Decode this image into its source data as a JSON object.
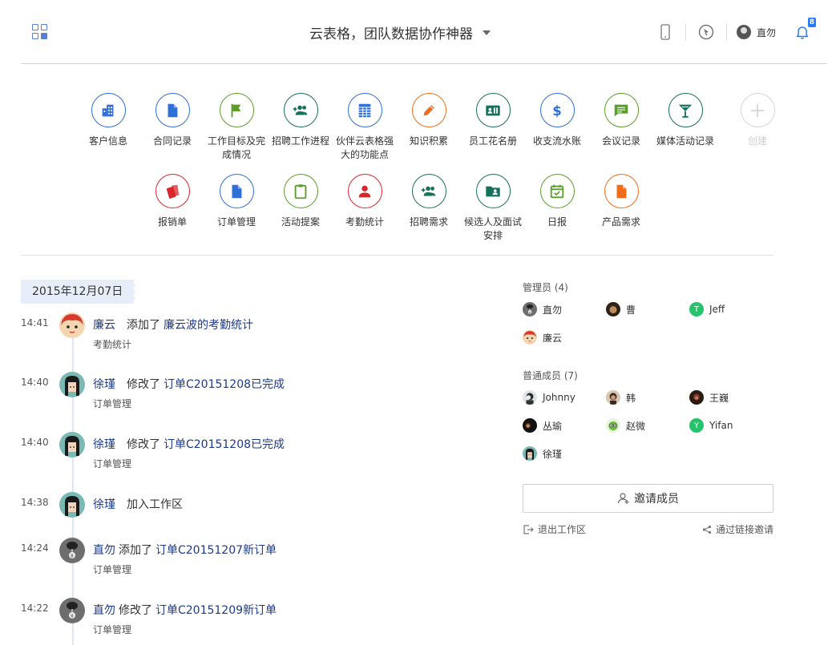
{
  "header": {
    "title": "云表格，团队数据协作神器",
    "user_name": "直勿",
    "notification_count": "8"
  },
  "apps": [
    {
      "label": "客户信息",
      "color": "#2f6fd6",
      "icon": "building-icon"
    },
    {
      "label": "合同记录",
      "color": "#2f6fd6",
      "icon": "document-icon"
    },
    {
      "label": "工作目标及完成情况",
      "color": "#5a9e2a",
      "icon": "flag-icon"
    },
    {
      "label": "招聘工作进程",
      "color": "#17705c",
      "icon": "group-add-icon"
    },
    {
      "label": "伙伴云表格强大的功能点",
      "color": "#2f6fd6",
      "icon": "table-icon"
    },
    {
      "label": "知识积累",
      "color": "#ef6c1a",
      "icon": "pencil-icon"
    },
    {
      "label": "员工花名册",
      "color": "#17705c",
      "icon": "contact-card-icon"
    },
    {
      "label": "收支流水账",
      "color": "#2f6fd6",
      "icon": "dollar-icon"
    },
    {
      "label": "会议记录",
      "color": "#5a9e2a",
      "icon": "chat-icon"
    },
    {
      "label": "媒体活动记录",
      "color": "#17705c",
      "icon": "cocktail-icon"
    },
    {
      "label": "创建",
      "color": "#d6d6d6",
      "icon": "plus-icon"
    },
    {
      "label": "报销单",
      "color": "#d8262b",
      "icon": "receipt-icon"
    },
    {
      "label": "订单管理",
      "color": "#2f6fd6",
      "icon": "document-icon"
    },
    {
      "label": "活动提案",
      "color": "#5a9e2a",
      "icon": "clipboard-icon"
    },
    {
      "label": "考勤统计",
      "color": "#d8262b",
      "icon": "person-icon"
    },
    {
      "label": "招聘需求",
      "color": "#17705c",
      "icon": "group-add-icon"
    },
    {
      "label": "候选人及面试安排",
      "color": "#17705c",
      "icon": "folder-person-icon"
    },
    {
      "label": "日报",
      "color": "#5a9e2a",
      "icon": "calendar-check-icon"
    },
    {
      "label": "产品需求",
      "color": "#ef6c1a",
      "icon": "document-icon"
    }
  ],
  "timeline": {
    "date": "2015年12月07日",
    "entries": [
      {
        "time": "14:41",
        "actor": "廉云",
        "action": "添加了",
        "target": "廉云波的考勤统计",
        "app": "考勤统计",
        "avatar": "lianyun"
      },
      {
        "time": "14:40",
        "actor": "徐瑾",
        "action": "修改了",
        "target": "订单C20151208已完成",
        "app": "订单管理",
        "avatar": "xujin"
      },
      {
        "time": "14:40",
        "actor": "徐瑾",
        "action": "修改了",
        "target": "订单C20151208已完成",
        "app": "订单管理",
        "avatar": "xujin"
      },
      {
        "time": "14:38",
        "actor": "徐瑾",
        "action": "加入工作区",
        "target": "",
        "app": "",
        "avatar": "xujin"
      },
      {
        "time": "14:24",
        "actor": "直勿",
        "action": "添加了",
        "target": "订单C20151207新订单",
        "app": "订单管理",
        "avatar": "zhiwu"
      },
      {
        "time": "14:22",
        "actor": "直勿",
        "action": "修改了",
        "target": "订单C20151209新订单",
        "app": "订单管理",
        "avatar": "zhiwu"
      }
    ]
  },
  "members": {
    "admins_title": "管理员 (4)",
    "admins": [
      {
        "name": "直勿",
        "avatar": "zhiwu"
      },
      {
        "name": "曹",
        "avatar": "cao"
      },
      {
        "name": "Jeff",
        "avatar": "letter",
        "letter": "T"
      },
      {
        "name": "廉云",
        "avatar": "lianyun"
      }
    ],
    "regular_title": "普通成员 (7)",
    "regular": [
      {
        "name": "Johnny",
        "avatar": "johnny"
      },
      {
        "name": "韩",
        "avatar": "han"
      },
      {
        "name": "王巍",
        "avatar": "wangwei"
      },
      {
        "name": "丛瑜",
        "avatar": "congyu"
      },
      {
        "name": "赵微",
        "avatar": "zhaowei"
      },
      {
        "name": "Yifan",
        "avatar": "letter",
        "letter": "Y"
      },
      {
        "name": "徐瑾",
        "avatar": "xujin"
      }
    ],
    "invite_label": "邀请成员",
    "leave_label": "退出工作区",
    "link_invite_label": "通过链接邀请"
  }
}
